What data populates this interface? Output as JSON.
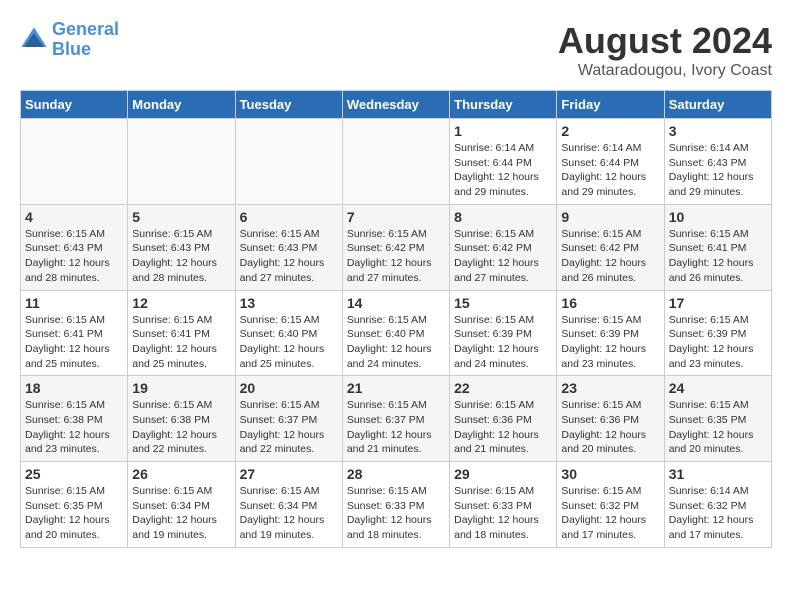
{
  "header": {
    "logo_line1": "General",
    "logo_line2": "Blue",
    "main_title": "August 2024",
    "subtitle": "Wataradougou, Ivory Coast"
  },
  "days_of_week": [
    "Sunday",
    "Monday",
    "Tuesday",
    "Wednesday",
    "Thursday",
    "Friday",
    "Saturday"
  ],
  "weeks": [
    [
      {
        "day": "",
        "info": ""
      },
      {
        "day": "",
        "info": ""
      },
      {
        "day": "",
        "info": ""
      },
      {
        "day": "",
        "info": ""
      },
      {
        "day": "1",
        "info": "Sunrise: 6:14 AM\nSunset: 6:44 PM\nDaylight: 12 hours\nand 29 minutes."
      },
      {
        "day": "2",
        "info": "Sunrise: 6:14 AM\nSunset: 6:44 PM\nDaylight: 12 hours\nand 29 minutes."
      },
      {
        "day": "3",
        "info": "Sunrise: 6:14 AM\nSunset: 6:43 PM\nDaylight: 12 hours\nand 29 minutes."
      }
    ],
    [
      {
        "day": "4",
        "info": "Sunrise: 6:15 AM\nSunset: 6:43 PM\nDaylight: 12 hours\nand 28 minutes."
      },
      {
        "day": "5",
        "info": "Sunrise: 6:15 AM\nSunset: 6:43 PM\nDaylight: 12 hours\nand 28 minutes."
      },
      {
        "day": "6",
        "info": "Sunrise: 6:15 AM\nSunset: 6:43 PM\nDaylight: 12 hours\nand 27 minutes."
      },
      {
        "day": "7",
        "info": "Sunrise: 6:15 AM\nSunset: 6:42 PM\nDaylight: 12 hours\nand 27 minutes."
      },
      {
        "day": "8",
        "info": "Sunrise: 6:15 AM\nSunset: 6:42 PM\nDaylight: 12 hours\nand 27 minutes."
      },
      {
        "day": "9",
        "info": "Sunrise: 6:15 AM\nSunset: 6:42 PM\nDaylight: 12 hours\nand 26 minutes."
      },
      {
        "day": "10",
        "info": "Sunrise: 6:15 AM\nSunset: 6:41 PM\nDaylight: 12 hours\nand 26 minutes."
      }
    ],
    [
      {
        "day": "11",
        "info": "Sunrise: 6:15 AM\nSunset: 6:41 PM\nDaylight: 12 hours\nand 25 minutes."
      },
      {
        "day": "12",
        "info": "Sunrise: 6:15 AM\nSunset: 6:41 PM\nDaylight: 12 hours\nand 25 minutes."
      },
      {
        "day": "13",
        "info": "Sunrise: 6:15 AM\nSunset: 6:40 PM\nDaylight: 12 hours\nand 25 minutes."
      },
      {
        "day": "14",
        "info": "Sunrise: 6:15 AM\nSunset: 6:40 PM\nDaylight: 12 hours\nand 24 minutes."
      },
      {
        "day": "15",
        "info": "Sunrise: 6:15 AM\nSunset: 6:39 PM\nDaylight: 12 hours\nand 24 minutes."
      },
      {
        "day": "16",
        "info": "Sunrise: 6:15 AM\nSunset: 6:39 PM\nDaylight: 12 hours\nand 23 minutes."
      },
      {
        "day": "17",
        "info": "Sunrise: 6:15 AM\nSunset: 6:39 PM\nDaylight: 12 hours\nand 23 minutes."
      }
    ],
    [
      {
        "day": "18",
        "info": "Sunrise: 6:15 AM\nSunset: 6:38 PM\nDaylight: 12 hours\nand 23 minutes."
      },
      {
        "day": "19",
        "info": "Sunrise: 6:15 AM\nSunset: 6:38 PM\nDaylight: 12 hours\nand 22 minutes."
      },
      {
        "day": "20",
        "info": "Sunrise: 6:15 AM\nSunset: 6:37 PM\nDaylight: 12 hours\nand 22 minutes."
      },
      {
        "day": "21",
        "info": "Sunrise: 6:15 AM\nSunset: 6:37 PM\nDaylight: 12 hours\nand 21 minutes."
      },
      {
        "day": "22",
        "info": "Sunrise: 6:15 AM\nSunset: 6:36 PM\nDaylight: 12 hours\nand 21 minutes."
      },
      {
        "day": "23",
        "info": "Sunrise: 6:15 AM\nSunset: 6:36 PM\nDaylight: 12 hours\nand 20 minutes."
      },
      {
        "day": "24",
        "info": "Sunrise: 6:15 AM\nSunset: 6:35 PM\nDaylight: 12 hours\nand 20 minutes."
      }
    ],
    [
      {
        "day": "25",
        "info": "Sunrise: 6:15 AM\nSunset: 6:35 PM\nDaylight: 12 hours\nand 20 minutes."
      },
      {
        "day": "26",
        "info": "Sunrise: 6:15 AM\nSunset: 6:34 PM\nDaylight: 12 hours\nand 19 minutes."
      },
      {
        "day": "27",
        "info": "Sunrise: 6:15 AM\nSunset: 6:34 PM\nDaylight: 12 hours\nand 19 minutes."
      },
      {
        "day": "28",
        "info": "Sunrise: 6:15 AM\nSunset: 6:33 PM\nDaylight: 12 hours\nand 18 minutes."
      },
      {
        "day": "29",
        "info": "Sunrise: 6:15 AM\nSunset: 6:33 PM\nDaylight: 12 hours\nand 18 minutes."
      },
      {
        "day": "30",
        "info": "Sunrise: 6:15 AM\nSunset: 6:32 PM\nDaylight: 12 hours\nand 17 minutes."
      },
      {
        "day": "31",
        "info": "Sunrise: 6:14 AM\nSunset: 6:32 PM\nDaylight: 12 hours\nand 17 minutes."
      }
    ]
  ]
}
